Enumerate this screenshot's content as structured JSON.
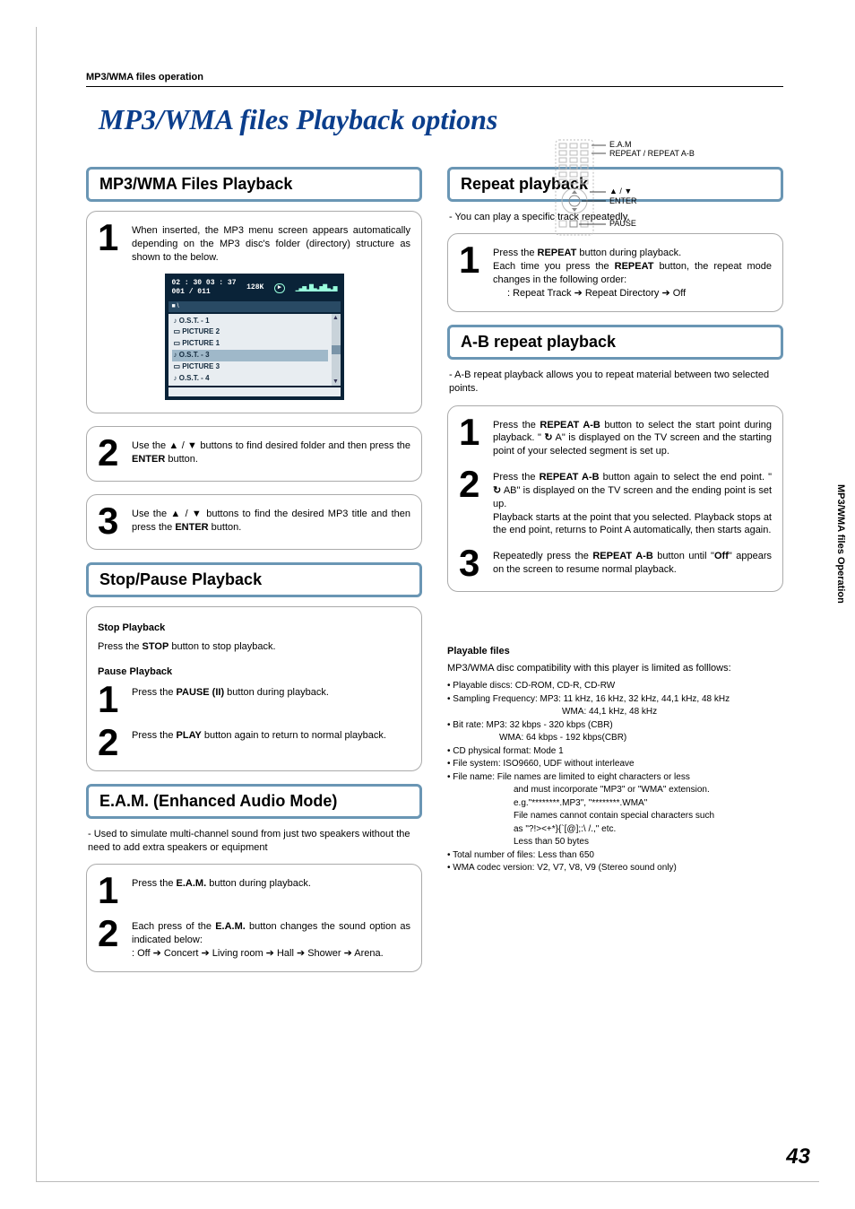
{
  "breadcrumb": "MP3/WMA files operation",
  "main_title": "MP3/WMA files Playback options",
  "side_tab": "MP3/WMA files Operation",
  "page_number": "43",
  "remote": {
    "l1": "E.A.M",
    "l2": "REPEAT / REPEAT A-B",
    "l3": "▲ / ▼",
    "l4": "ENTER",
    "l5": "PAUSE"
  },
  "left": {
    "sec1_title": "MP3/WMA Files Playback",
    "s1_step1": "When inserted, the MP3 menu screen appears automatically depending on the MP3 disc's folder (directory) structure as shown to the below.",
    "screen": {
      "time": "02 : 30    03 : 37",
      "count": "001 / 011",
      "rate": "128K",
      "crumb": "■  \\",
      "items": [
        "O.S.T. - 1",
        "PICTURE 2",
        "PICTURE 1",
        "O.S.T. - 3",
        "PICTURE 3",
        "O.S.T. - 4"
      ],
      "sel_index": 3
    },
    "s1_step2_a": "Use the ",
    "s1_step2_arrows": "▲ / ▼",
    "s1_step2_b": "  buttons  to find desired folder and then press the ",
    "s1_step2_enter": "ENTER",
    "s1_step2_c": " button.",
    "s1_step3_a": "Use the ",
    "s1_step3_arrows": "▲ / ▼",
    "s1_step3_b": " buttons to find the desired MP3 title and then press the ",
    "s1_step3_enter": "ENTER",
    "s1_step3_c": " button.",
    "sec2_title": "Stop/Pause Playback",
    "stop_h": "Stop Playback",
    "stop_a": "Press the ",
    "stop_btn": "STOP",
    "stop_b": " button to stop playback.",
    "pause_h": "Pause Playback",
    "p_s1_a": "Press the  ",
    "p_s1_btn": "PAUSE (II)",
    "p_s1_b": " button during playback.",
    "p_s2_a": "Press the ",
    "p_s2_btn": "PLAY",
    "p_s2_b": " button again to return to normal playback.",
    "sec3_title": "E.A.M. (Enhanced Audio Mode)",
    "eam_intro": "- Used to simulate multi-channel sound from just two speakers without the need to add extra speakers or equipment",
    "eam_s1_a": "Press the ",
    "eam_s1_btn": "E.A.M.",
    "eam_s1_b": " button during playback.",
    "eam_s2_a": "Each press of the ",
    "eam_s2_btn": "E.A.M.",
    "eam_s2_b": "  button changes the sound option as indicated below:",
    "eam_s2_chain": ": Off ➔ Concert ➔ Living room ➔ Hall ➔ Shower ➔ Arena."
  },
  "right": {
    "sec1_title": "Repeat playback",
    "rep_intro": "-  You can play a specific track repeatedly.",
    "rep_s1_a": "Press the ",
    "rep_s1_btn": "REPEAT",
    "rep_s1_b": "  button during playback.",
    "rep_s1_c": "Each time you press the ",
    "rep_s1_btn2": "REPEAT",
    "rep_s1_d": "  button, the repeat mode changes in the following order:",
    "rep_s1_chain": ": Repeat Track ➔ Repeat Directory ➔ Off",
    "sec2_title": "A-B repeat playback",
    "ab_intro": "-  A-B repeat playback allows you to repeat material between two selected points.",
    "ab_s1_a": "Press the ",
    "ab_s1_btn": "REPEAT A-B",
    "ab_s1_b": " button to select the start point during playback. \" ",
    "ab_s1_c": " A\" is displayed on the TV screen and the starting point of your selected segment is set up.",
    "ab_s2_a": "Press the ",
    "ab_s2_btn": "REPEAT A-B",
    "ab_s2_b": " button again to select the end point. \" ",
    "ab_s2_c": " AB\" is displayed on the TV screen and the ending point is set up.",
    "ab_s2_d": "Playback starts at the point that you selected. Playback stops at the end point, returns to Point A automatically, then starts again.",
    "ab_s3_a": "Repeatedly press the ",
    "ab_s3_btn": "REPEAT A-B",
    "ab_s3_b": " button until \"",
    "ab_s3_off": "Off",
    "ab_s3_c": "\" appears on the screen to resume normal playback.",
    "pf_title": "Playable files",
    "pf_intro": "MP3/WMA disc compatibility with this player is limited as folllows:",
    "pf": {
      "l1": "Playable discs: CD-ROM, CD-R, CD-RW",
      "l2": "Sampling Frequency: MP3: 11 kHz, 16 kHz, 32 kHz, 44,1 kHz, 48 kHz",
      "l2b": "WMA: 44,1 kHz, 48 kHz",
      "l3": "Bit rate: MP3: 32 kbps - 320 kbps (CBR)",
      "l3b": "WMA: 64 kbps - 192 kbps(CBR)",
      "l4": "CD physical format: Mode 1",
      "l5": "File system: ISO9660, UDF without interleave",
      "l6": "File name: File names are limited to eight characters or less",
      "l6b": "and must incorporate \"MP3\" or \"WMA\" extension.",
      "l6c": "e.g.\"********.MP3\", \"********.WMA\"",
      "l6d": "File names cannot contain special characters such",
      "l6e": "as \"?!><+*}{`[@];:\\ /.,\" etc.",
      "l6f": "Less than 50 bytes",
      "l7": "Total number of files: Less than 650",
      "l8": "WMA codec version: V2, V7, V8, V9 (Stereo sound only)"
    }
  }
}
